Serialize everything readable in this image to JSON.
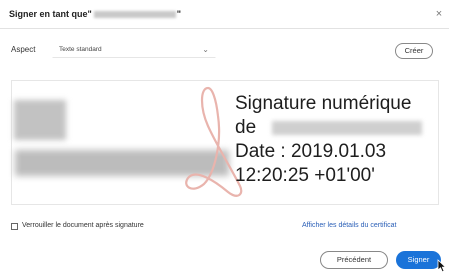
{
  "dialog": {
    "title_prefix": "Signer en tant que\"",
    "title_suffix": "\"",
    "close_glyph": "×"
  },
  "appearance": {
    "label": "Aspect",
    "selected": "Texte standard",
    "create_label": "Créer"
  },
  "signature_preview": {
    "line1": "Signature numérique",
    "line2": "de",
    "line3": "Date : 2019.01.03",
    "line4": "12:20:25 +01'00'"
  },
  "options": {
    "lock_label": "Verrouiller le document après signature",
    "details_link": "Afficher les détails du certificat"
  },
  "footer": {
    "previous_label": "Précédent",
    "sign_label": "Signer"
  },
  "colors": {
    "primary": "#1a73d9",
    "link": "#2a5fb7"
  }
}
